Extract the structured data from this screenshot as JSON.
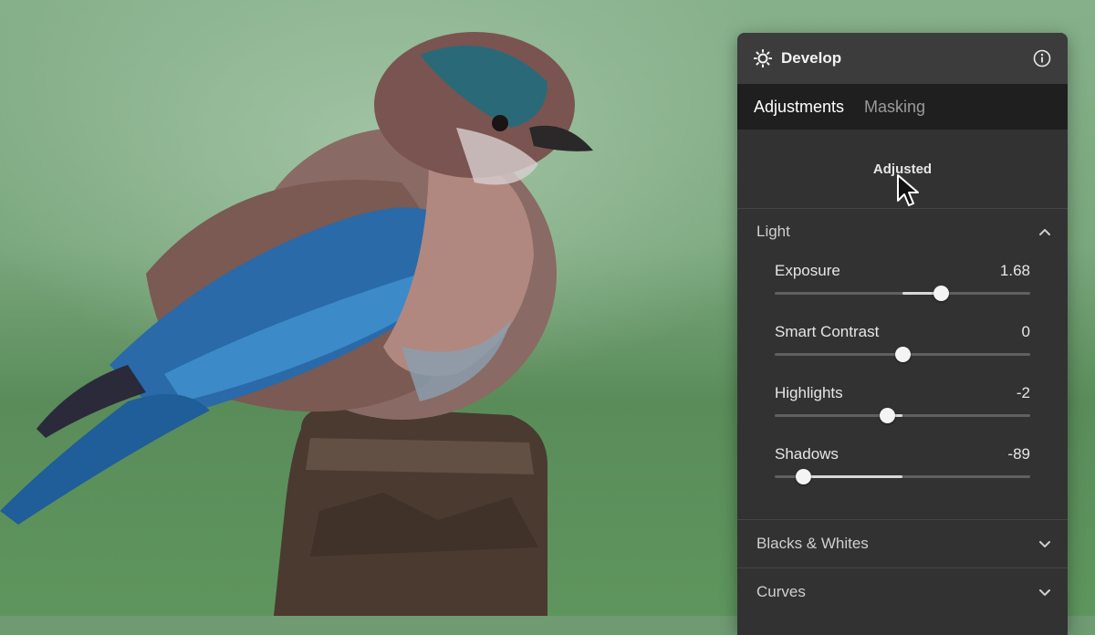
{
  "panel": {
    "title": "Develop",
    "icon": "sun-icon",
    "info_icon": "info-icon"
  },
  "tabs": [
    {
      "label": "Adjustments",
      "active": true
    },
    {
      "label": "Masking",
      "active": false
    }
  ],
  "adjusted_label": "Adjusted",
  "sections": {
    "light": {
      "label": "Light",
      "expanded": true,
      "icon": "chevron-up-icon"
    },
    "blacks_whites": {
      "label": "Blacks & Whites",
      "expanded": false,
      "icon": "chevron-down-icon"
    },
    "curves": {
      "label": "Curves",
      "expanded": false,
      "icon": "chevron-down-icon"
    }
  },
  "sliders": [
    {
      "label": "Exposure",
      "value": "1.68",
      "position": 0.65
    },
    {
      "label": "Smart Contrast",
      "value": "0",
      "position": 0.5
    },
    {
      "label": "Highlights",
      "value": "-2",
      "position": 0.44
    },
    {
      "label": "Shadows",
      "value": "-89",
      "position": 0.11
    }
  ],
  "colors": {
    "panel_bg": "#323232",
    "header_bg": "#3c3c3c",
    "tabs_bg": "#1f1f1f"
  }
}
